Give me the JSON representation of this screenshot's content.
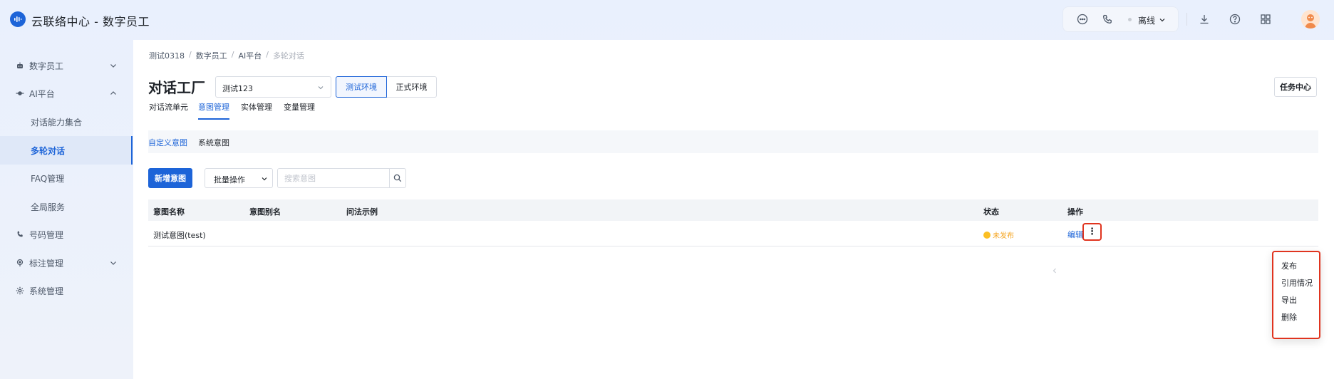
{
  "header": {
    "title": "云联络中心 - 数字员工",
    "status": "离线",
    "icons": [
      "chat-icon",
      "phone-icon",
      "download-icon",
      "help-icon",
      "apps-grid-icon"
    ]
  },
  "sidebar": {
    "items": [
      {
        "label": "数字员工",
        "icon": "robot-icon",
        "expandable": true
      },
      {
        "label": "AI平台",
        "icon": "ai-node-icon",
        "expandable": true,
        "expanded": true
      },
      {
        "label": "对话能力集合"
      },
      {
        "label": "多轮对话",
        "active": true
      },
      {
        "label": "FAQ管理"
      },
      {
        "label": "全局服务"
      },
      {
        "label": "号码管理",
        "icon": "phone-icon"
      },
      {
        "label": "标注管理",
        "icon": "tag-icon",
        "expandable": true
      },
      {
        "label": "系统管理",
        "icon": "gear-icon"
      }
    ]
  },
  "breadcrumb": [
    "测试0318",
    "数字员工",
    "AI平台",
    "多轮对话"
  ],
  "page": {
    "title": "对话工厂",
    "selected_bot": "测试123",
    "env_test": "测试环境",
    "env_prod": "正式环境",
    "task_center": "任务中心"
  },
  "tabs": [
    "对话流单元",
    "意图管理",
    "实体管理",
    "变量管理"
  ],
  "active_tab": "意图管理",
  "subtabs": [
    "自定义意图",
    "系统意图"
  ],
  "toolbar": {
    "new_button": "新增意图",
    "batch_button": "批量操作",
    "search_placeholder": "搜索意图"
  },
  "table": {
    "headers": [
      "意图名称",
      "意图别名",
      "问法示例",
      "状态",
      "操作"
    ],
    "rows": [
      {
        "name": "测试意图(test)",
        "alias": "",
        "example": "",
        "status": "未发布",
        "action": "编辑"
      }
    ]
  },
  "dropdown": {
    "items": [
      "发布",
      "引用情况",
      "导出",
      "删除"
    ]
  },
  "colors": {
    "primary": "#1d64d8",
    "highlight": "#e0341f",
    "status_unpublished": "#f5a623"
  }
}
